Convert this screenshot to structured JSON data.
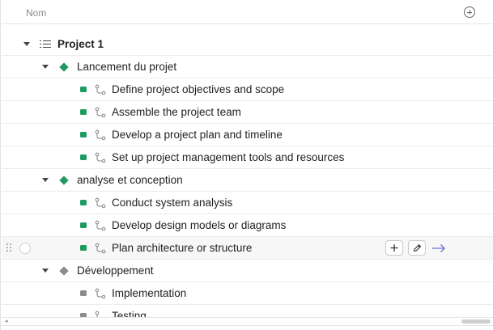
{
  "header": {
    "column_title": "Nom",
    "add_column_icon": "plus-circle-icon"
  },
  "colors": {
    "phase_active": "#1e9a63",
    "phase_inactive": "#8c8c8c",
    "arrow_accent": "#6d6cd8"
  },
  "rows": [
    {
      "kind": "project",
      "label": "Project 1"
    },
    {
      "kind": "phase",
      "label": "Lancement du projet",
      "status": "active"
    },
    {
      "kind": "task",
      "label": "Define project objectives and scope",
      "status": "active"
    },
    {
      "kind": "task",
      "label": "Assemble the project team",
      "status": "active"
    },
    {
      "kind": "task",
      "label": "Develop a project plan and timeline",
      "status": "active"
    },
    {
      "kind": "task",
      "label": "Set up project management tools and resources",
      "status": "active"
    },
    {
      "kind": "phase",
      "label": "analyse et conception",
      "status": "active"
    },
    {
      "kind": "task",
      "label": "Conduct system analysis",
      "status": "active"
    },
    {
      "kind": "task",
      "label": "Develop design models or diagrams",
      "status": "active"
    },
    {
      "kind": "task",
      "label": "Plan architecture or structure",
      "status": "active",
      "hovered": true
    },
    {
      "kind": "phase",
      "label": "Développement",
      "status": "inactive"
    },
    {
      "kind": "task",
      "label": "Implementation",
      "status": "inactive"
    },
    {
      "kind": "task",
      "label": "Testing",
      "status": "inactive",
      "partial": true
    }
  ],
  "row_actions": {
    "add_icon": "plus-icon",
    "edit_icon": "pencil-icon",
    "open_icon": "arrow-right-icon"
  }
}
